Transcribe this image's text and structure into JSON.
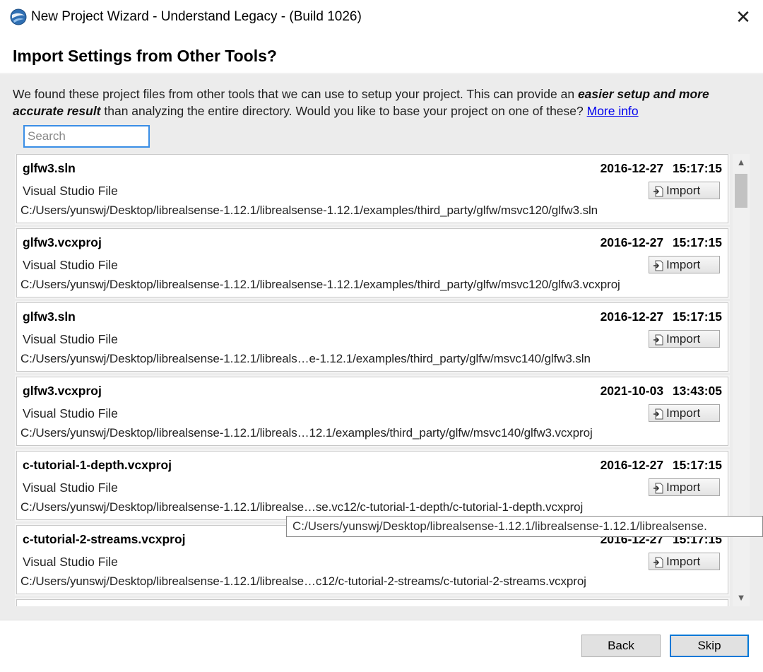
{
  "window": {
    "title": "New Project Wizard - Understand Legacy - (Build 1026)",
    "close_glyph": "✕"
  },
  "header": {
    "title": "Import Settings from Other Tools?"
  },
  "intro": {
    "text_1": "We found these project files from other tools that we can use to setup your project. This can provide an ",
    "emphasis": "easier setup and more accurate result",
    "text_2": " than analyzing the entire directory. Would you like to base your project on one of these? ",
    "link": "More info"
  },
  "search": {
    "placeholder": "Search",
    "value": ""
  },
  "projects": [
    {
      "name": "glfw3.sln",
      "date": "2016-12-27 15:17:15",
      "type": "Visual Studio File",
      "import_label": "Import",
      "path": "C:/Users/yunswj/Desktop/librealsense-1.12.1/librealsense-1.12.1/examples/third_party/glfw/msvc120/glfw3.sln"
    },
    {
      "name": "glfw3.vcxproj",
      "date": "2016-12-27 15:17:15",
      "type": "Visual Studio File",
      "import_label": "Import",
      "path": "C:/Users/yunswj/Desktop/librealsense-1.12.1/librealsense-1.12.1/examples/third_party/glfw/msvc120/glfw3.vcxproj"
    },
    {
      "name": "glfw3.sln",
      "date": "2016-12-27 15:17:15",
      "type": "Visual Studio File",
      "import_label": "Import",
      "path": "C:/Users/yunswj/Desktop/librealsense-1.12.1/libreals…e-1.12.1/examples/third_party/glfw/msvc140/glfw3.sln"
    },
    {
      "name": "glfw3.vcxproj",
      "date": "2021-10-03 13:43:05",
      "type": "Visual Studio File",
      "import_label": "Import",
      "path": "C:/Users/yunswj/Desktop/librealsense-1.12.1/libreals…12.1/examples/third_party/glfw/msvc140/glfw3.vcxproj"
    },
    {
      "name": "c-tutorial-1-depth.vcxproj",
      "date": "2016-12-27 15:17:15",
      "type": "Visual Studio File",
      "import_label": "Import",
      "path": "C:/Users/yunswj/Desktop/librealsense-1.12.1/librealse…se.vc12/c-tutorial-1-depth/c-tutorial-1-depth.vcxproj"
    },
    {
      "name": "c-tutorial-2-streams.vcxproj",
      "date": "2016-12-27 15:17:15",
      "type": "Visual Studio File",
      "import_label": "Import",
      "path": "C:/Users/yunswj/Desktop/librealsense-1.12.1/librealse…c12/c-tutorial-2-streams/c-tutorial-2-streams.vcxproj"
    }
  ],
  "tooltip": {
    "text": "C:/Users/yunswj/Desktop/librealsense-1.12.1/librealsense-1.12.1/librealsense."
  },
  "scrollbar": {
    "up_glyph": "▲",
    "down_glyph": "▼"
  },
  "footer": {
    "back_label": "Back",
    "skip_label": "Skip"
  },
  "colors": {
    "accent": "#0078d7",
    "link": "#0000ee",
    "panel_bg": "#ececec"
  }
}
